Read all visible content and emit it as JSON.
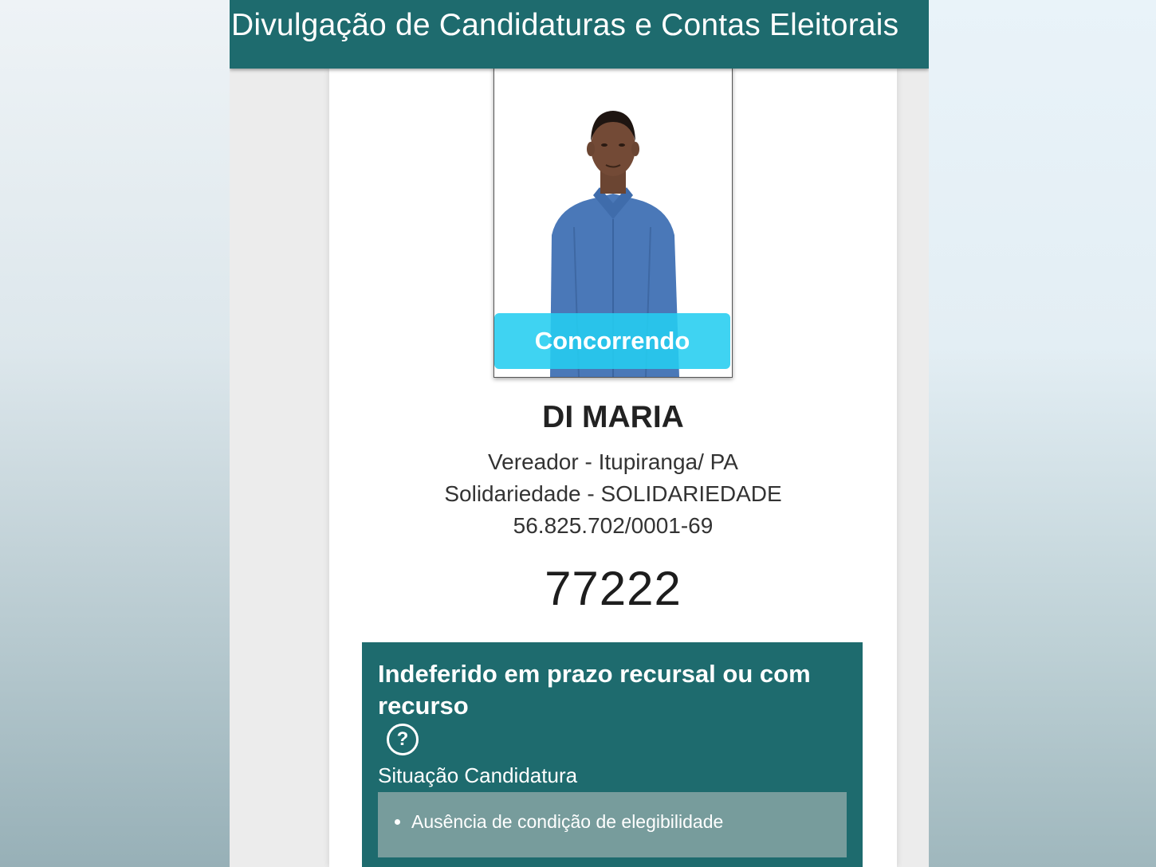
{
  "header": {
    "title": "Divulgação de Candidaturas e Contas Eleitorais"
  },
  "candidate": {
    "photo_badge": "Concorrendo",
    "name": "DI MARIA",
    "office_location": "Vereador - Itupiranga/ PA",
    "party": "Solidariedade - SOLIDARIEDADE",
    "cnpj": "56.825.702/0001-69",
    "number": "77222"
  },
  "status_panel": {
    "title": "Indeferido em prazo recursal ou com recurso",
    "help_icon": "question-circle-icon",
    "label": "Situação Candidatura",
    "reasons": [
      "Ausência de condição de elegibilidade"
    ]
  },
  "colors": {
    "header_teal": "#1e6b6e",
    "badge_cyan": "#24cdf0",
    "reasons_box": "#779c9c"
  }
}
